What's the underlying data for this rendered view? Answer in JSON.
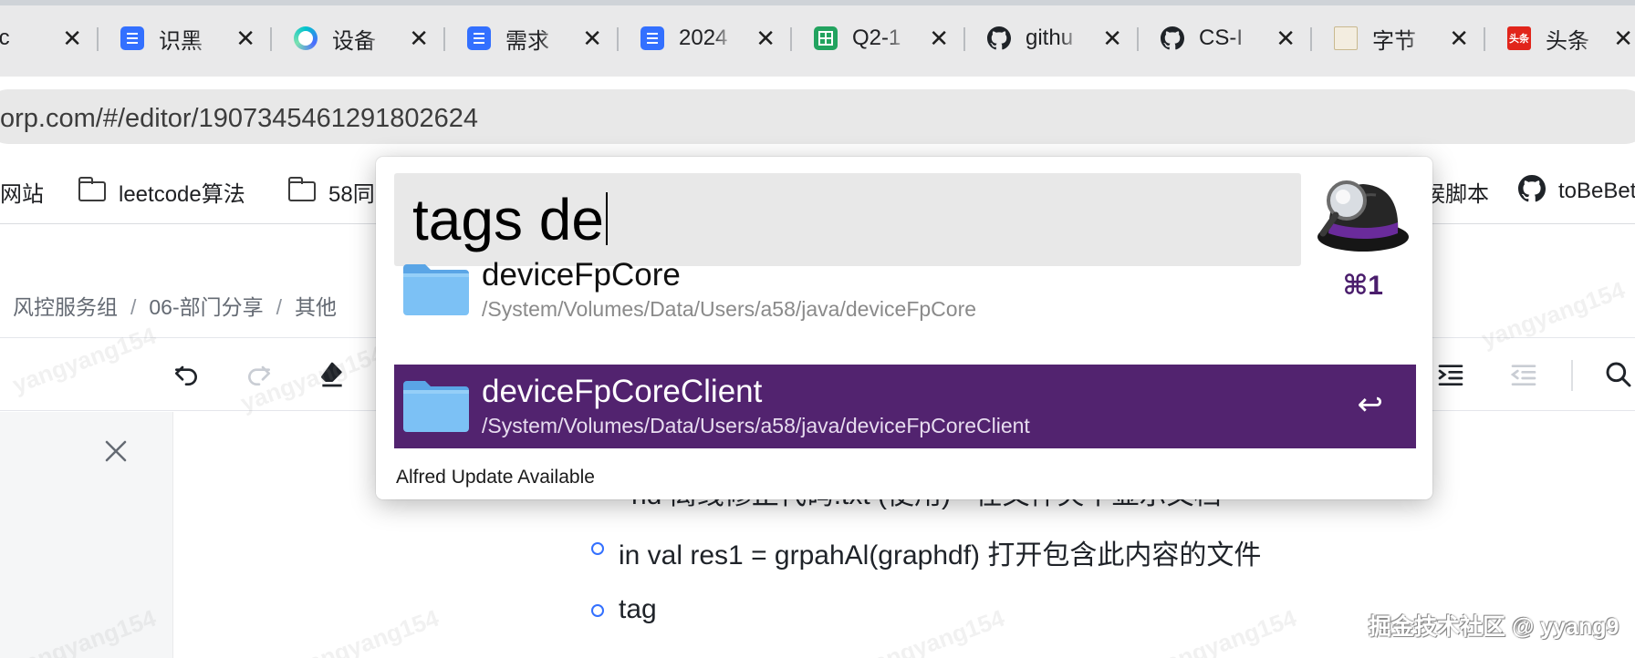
{
  "tabs": [
    {
      "title": "Disc",
      "icon": "discord-favicon-icon"
    },
    {
      "title": "识黑",
      "icon": "lark-doc-icon"
    },
    {
      "title": "设备",
      "icon": "round-app-icon"
    },
    {
      "title": "需求",
      "icon": "lark-doc-icon"
    },
    {
      "title": "2024",
      "icon": "lark-doc-icon"
    },
    {
      "title": "Q2-1",
      "icon": "lark-sheet-icon"
    },
    {
      "title": "githu",
      "icon": "github-icon"
    },
    {
      "title": "CS-I",
      "icon": "github-icon"
    },
    {
      "title": "字节",
      "icon": "page-icon"
    },
    {
      "title": "头条",
      "icon": "toutiao-icon"
    }
  ],
  "tab_close_glyph": "✕",
  "toutiao_badge": "头条",
  "address": {
    "url": "orp.com/#/editor/1907345461291802624"
  },
  "bookmarks": [
    {
      "label": "网站"
    },
    {
      "label": "leetcode算法"
    },
    {
      "label": "58同"
    },
    {
      "label": "候脚本"
    },
    {
      "label": "toBeBet"
    }
  ],
  "breadcrumb": [
    "风控服务组",
    "06-部门分享",
    "其他"
  ],
  "content_lines": [
    "nd 离线修正代码.txt (使用) - 在文件夹中显示文档",
    "in val res1 = grpahAl(graphdf)  打开包含此内容的文件",
    "tag"
  ],
  "watermark_user": "yangyang154",
  "site_watermark": "掘金技术社区 @ yyang9",
  "alfred": {
    "query": "tags de",
    "results": [
      {
        "name": "deviceFpCore",
        "path": "/System/Volumes/Data/Users/a58/java/deviceFpCore",
        "shortcut": "⌘1",
        "selected": false
      },
      {
        "name": "deviceFpCoreClient",
        "path": "/System/Volumes/Data/Users/a58/java/deviceFpCoreClient",
        "shortcut": "↩",
        "selected": true
      }
    ],
    "update_notice": "Alfred Update Available",
    "colors": {
      "selection": "#52236f",
      "shortcut": "#4a1d6c"
    }
  }
}
